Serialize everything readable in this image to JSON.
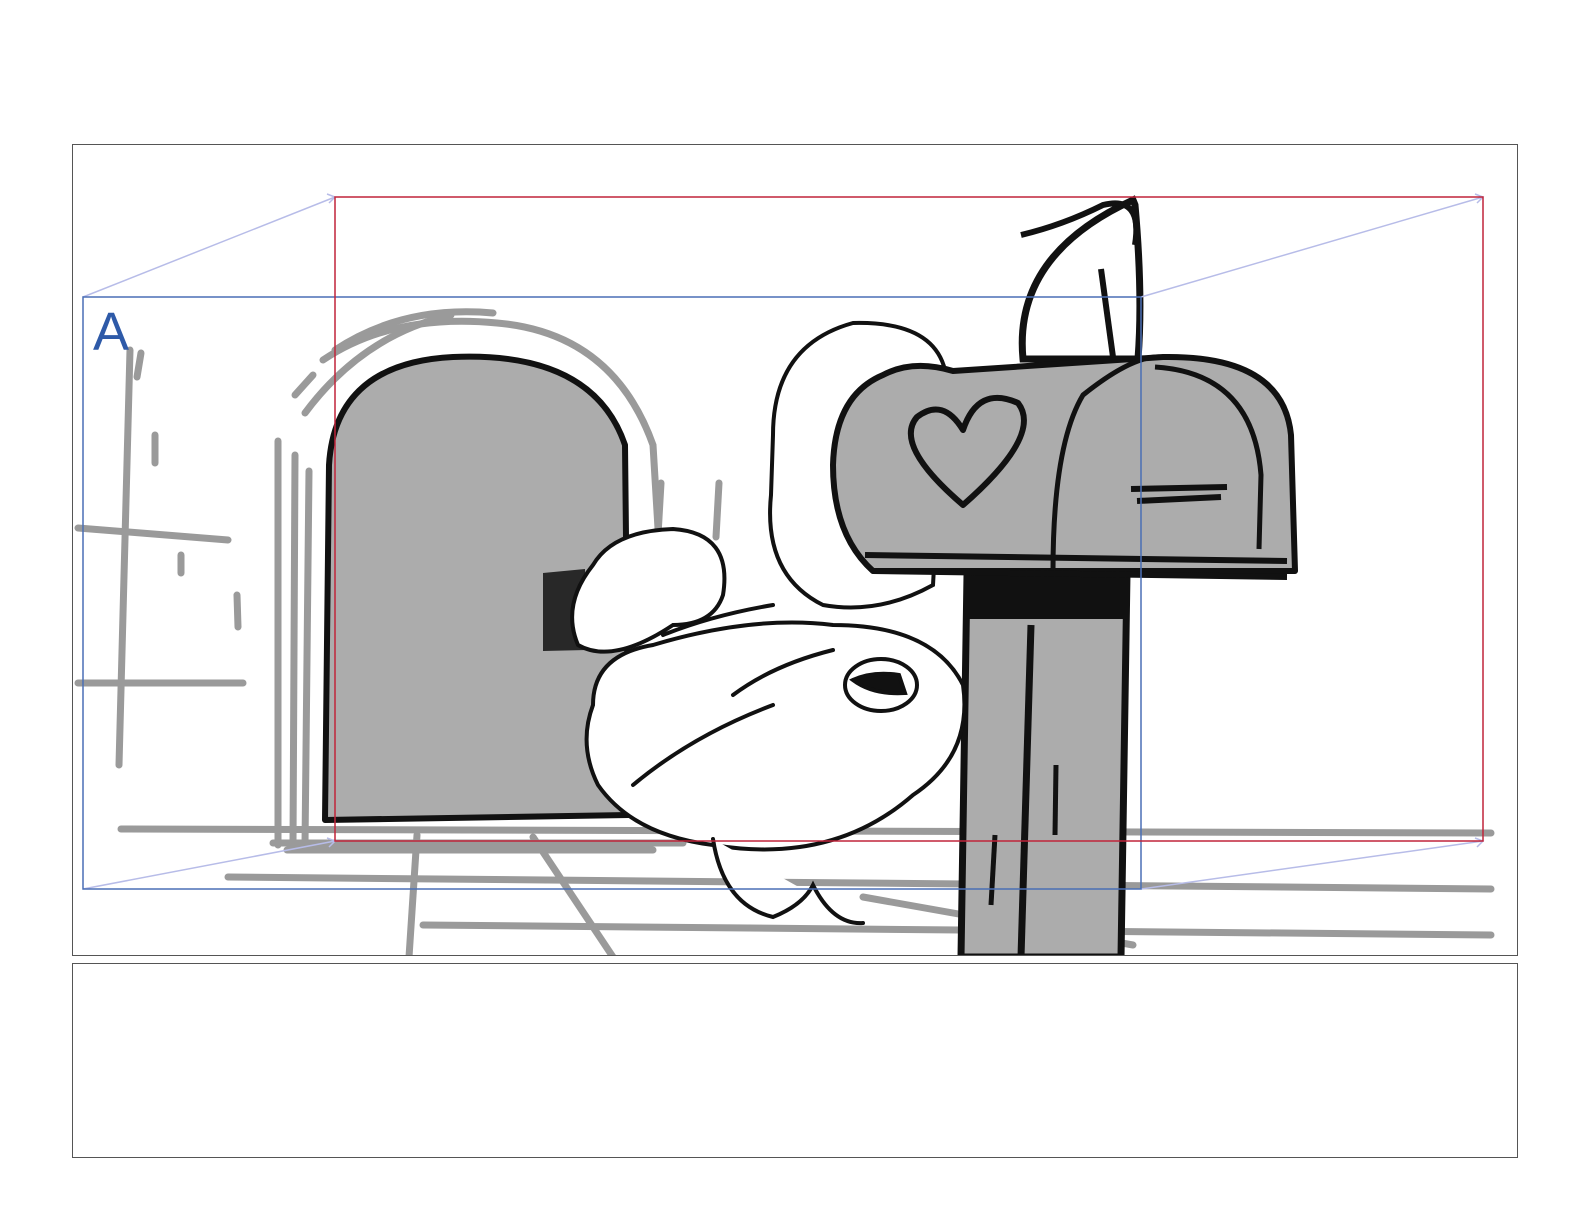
{
  "storyboard": {
    "panel": {
      "frame_label": "A"
    },
    "notes": {
      "text": ""
    }
  },
  "colors": {
    "panel_border": "#555555",
    "frame_a": "#4a6fb5",
    "frame_b": "#c0243a",
    "camera_move_guides": "#b7bce8",
    "sketch_ink": "#111111",
    "sketch_gray_lines": "#9a9a9a",
    "sketch_fill": "#acacac"
  }
}
